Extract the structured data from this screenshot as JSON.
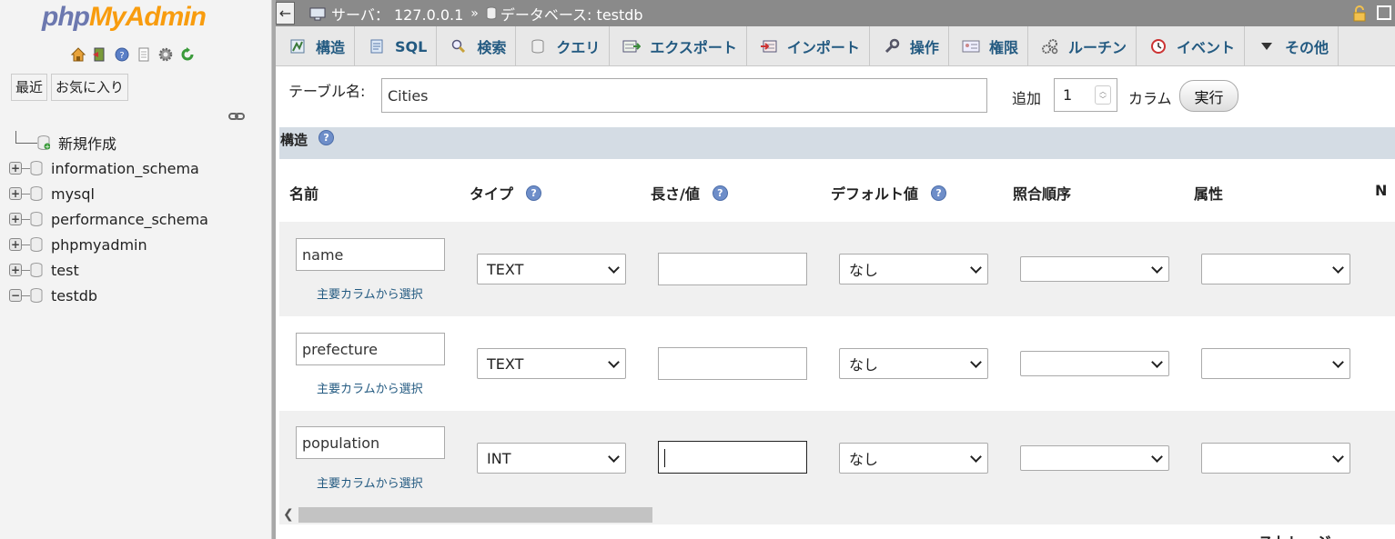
{
  "nav": {
    "logo_php": "php",
    "logo_myadmin": "MyAdmin",
    "icons": [
      "home-icon",
      "exit-icon",
      "help-icon",
      "docs-icon",
      "settings-icon",
      "reload-icon"
    ],
    "recent_label": "最近",
    "favorites_label": "お気に入り",
    "tree": [
      {
        "label": "新規作成",
        "type": "new"
      },
      {
        "label": "information_schema",
        "expander": "+"
      },
      {
        "label": "mysql",
        "expander": "+"
      },
      {
        "label": "performance_schema",
        "expander": "+"
      },
      {
        "label": "phpmyadmin",
        "expander": "+"
      },
      {
        "label": "test",
        "expander": "+"
      },
      {
        "label": "testdb",
        "expander": "−"
      }
    ]
  },
  "topbar": {
    "back": "←",
    "server_label": "サーバ：",
    "server_value": "127.0.0.1",
    "separator": "»",
    "db_label": "データベース:",
    "db_value": "testdb"
  },
  "tabs": [
    {
      "label": "構造",
      "icon": "structure-icon"
    },
    {
      "label": "SQL",
      "icon": "sql-icon"
    },
    {
      "label": "検索",
      "icon": "search-icon"
    },
    {
      "label": "クエリ",
      "icon": "query-icon"
    },
    {
      "label": "エクスポート",
      "icon": "export-icon"
    },
    {
      "label": "インポート",
      "icon": "import-icon"
    },
    {
      "label": "操作",
      "icon": "wrench-icon"
    },
    {
      "label": "権限",
      "icon": "privileges-icon"
    },
    {
      "label": "ルーチン",
      "icon": "routines-icon"
    },
    {
      "label": "イベント",
      "icon": "events-icon"
    },
    {
      "label": "その他",
      "icon": "chevron-down-icon"
    }
  ],
  "form": {
    "table_name_label": "テーブル名:",
    "table_name_value": "Cities",
    "add_label": "追加",
    "add_value": "1",
    "column_label": "カラム",
    "go_label": "実行",
    "section_title": "構造",
    "headers": {
      "name": "名前",
      "type": "タイプ",
      "length": "長さ/値",
      "default": "デフォルト値",
      "collation": "照合順序",
      "attributes": "属性",
      "null_cut": "N"
    },
    "pick_label": "主要カラムから選択",
    "rows": [
      {
        "name": "name",
        "type": "TEXT",
        "length": "",
        "default": "なし",
        "collation": "",
        "attributes": ""
      },
      {
        "name": "prefecture",
        "type": "TEXT",
        "length": "",
        "default": "なし",
        "collation": "",
        "attributes": ""
      },
      {
        "name": "population",
        "type": "INT",
        "length": "",
        "default": "なし",
        "collation": "",
        "attributes": ""
      }
    ],
    "bottom_cut": "ストレージ"
  }
}
